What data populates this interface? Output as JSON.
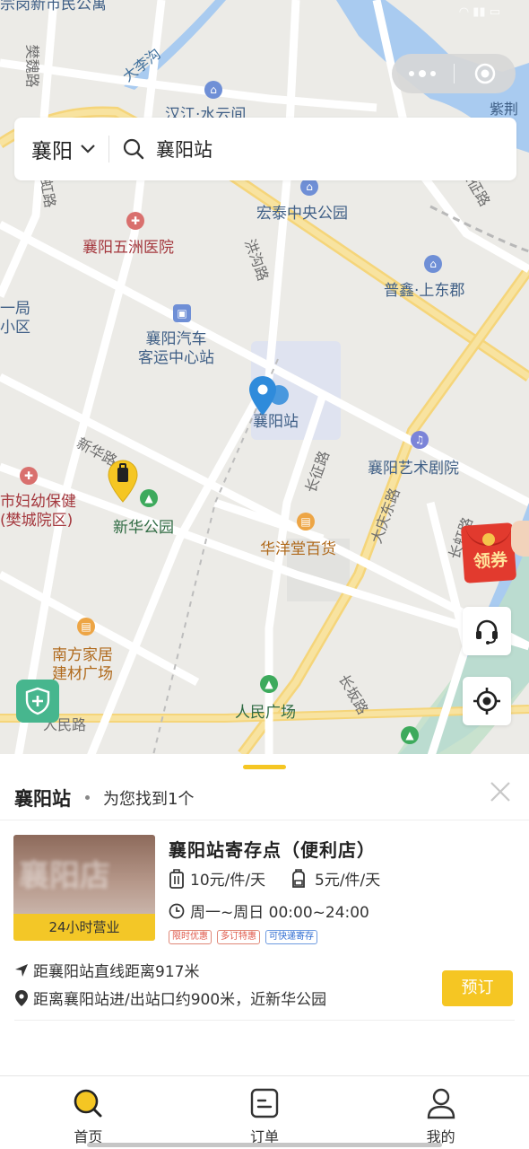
{
  "map": {
    "road_labels": [
      "大李沟",
      "樊魏路",
      "长虹路",
      "洪沟路",
      "新华路",
      "长征路",
      "大庆东路",
      "长虹路",
      "长坂路",
      "人民路",
      "长征路",
      "紫荆"
    ],
    "places": {
      "top_left": "宗岗新市民公寓",
      "hanjiang": "汉江·水云间",
      "hongtai": "宏泰中央公园",
      "hospital": "襄阳五洲医院",
      "puxin": "普鑫·上东郡",
      "yiju": "一局\n小区",
      "bus_station": "襄阳汽车\n客运中心站",
      "station": "襄阳站",
      "theater": "襄阳艺术剧院",
      "maternity": "市妇幼保健\n(樊城院区)",
      "xinhua_park": "新华公园",
      "huayang": "华洋堂百货",
      "nanfang": "南方家居\n建材广场",
      "renmin_square": "人民广场",
      "renmin_road": "人民路"
    }
  },
  "search": {
    "city": "襄阳",
    "query": "襄阳站"
  },
  "coupon": {
    "label": "领券"
  },
  "sheet": {
    "title": "襄阳站",
    "found": "为您找到1个"
  },
  "result": {
    "thumb_badge": "24小时营业",
    "name": "襄阳站寄存点（便利店）",
    "price_large": "10元/件/天",
    "price_small": "5元/件/天",
    "hours": "周一~周日 00:00~24:00",
    "tags": [
      "限时优惠",
      "多订特惠",
      "可快递寄存"
    ],
    "distance_straight": "距襄阳站直线距离917米",
    "distance_walk": "距离襄阳站进/出站口约900米，近新华公园",
    "book_label": "预订"
  },
  "tabs": [
    {
      "label": "首页",
      "icon": "search-icon",
      "active": true
    },
    {
      "label": "订单",
      "icon": "order-icon",
      "active": false
    },
    {
      "label": "我的",
      "icon": "user-icon",
      "active": false
    }
  ],
  "colors": {
    "accent": "#F5C623",
    "map_bg": "#ECEBE7",
    "water": "#A9CBF0",
    "pin_blue": "#2F8BDB"
  }
}
